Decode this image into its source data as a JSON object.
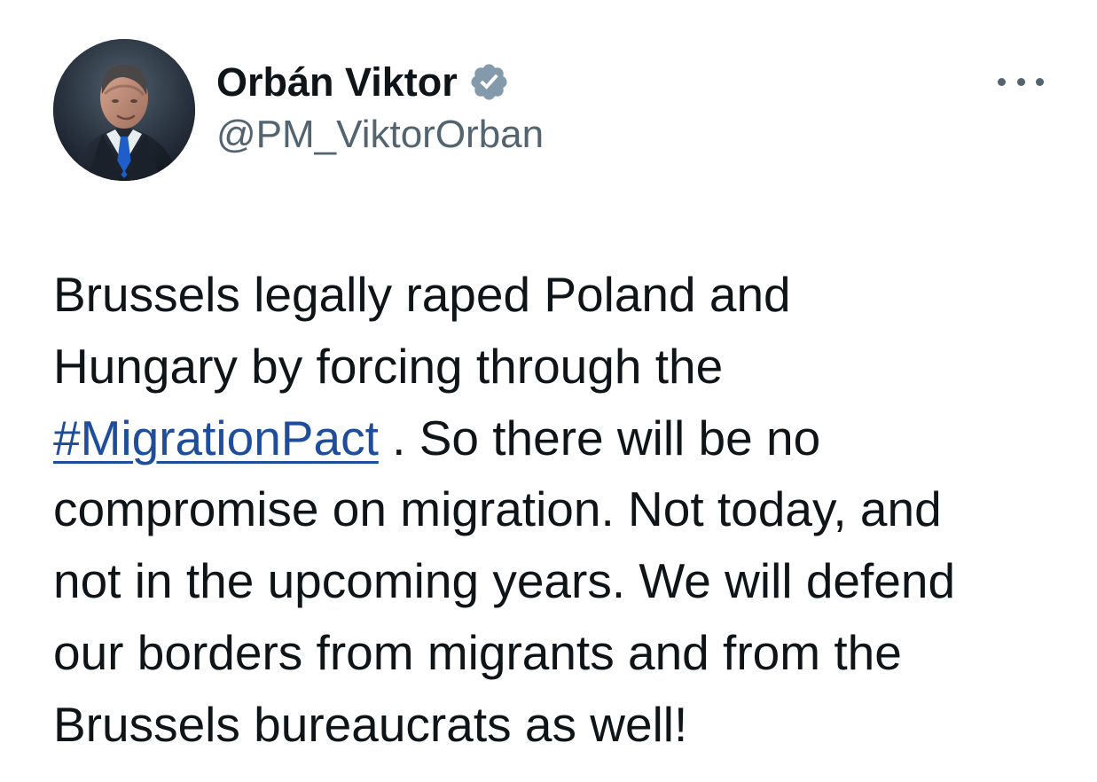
{
  "author": {
    "display_name": "Orbán Viktor",
    "handle": "@PM_ViktorOrban",
    "verified": true,
    "avatar_icon": "profile-photo",
    "verified_icon": "verified-badge-icon",
    "verified_color": "#829aab"
  },
  "menu": {
    "more_icon": "more-options-icon"
  },
  "tweet": {
    "lines": [
      {
        "before": "Brussels legally raped Poland and",
        "hashtag": "",
        "after": ""
      },
      {
        "before": "Hungary by forcing through the",
        "hashtag": "",
        "after": ""
      },
      {
        "before": "",
        "hashtag": "#MigrationPact",
        "after": " . So there will be no"
      },
      {
        "before": "compromise on migration. Not today, and",
        "hashtag": "",
        "after": ""
      },
      {
        "before": "not in the upcoming years. We will defend",
        "hashtag": "",
        "after": ""
      },
      {
        "before": "our borders from migrants and from the",
        "hashtag": "",
        "after": ""
      },
      {
        "before": "Brussels bureaucrats as well!",
        "hashtag": "",
        "after": ""
      }
    ],
    "hashtag_color": "#1d4d9b"
  }
}
